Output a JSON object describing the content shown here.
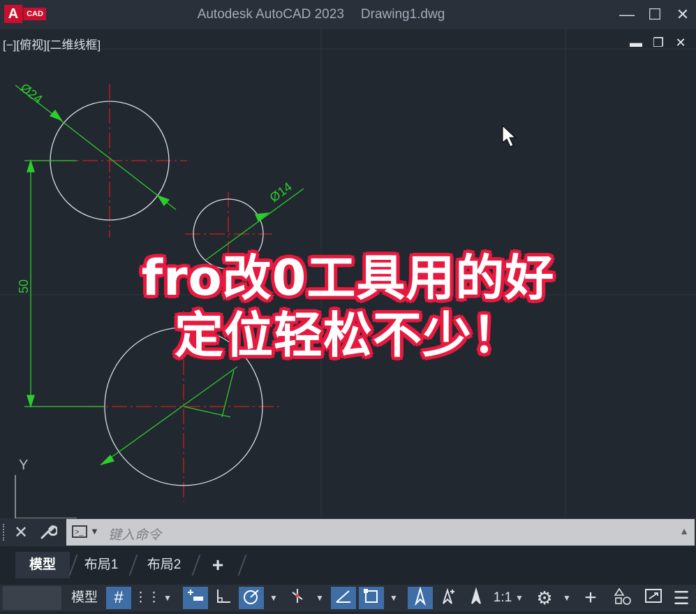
{
  "app": {
    "logo_letter": "A",
    "logo_text": "CAD",
    "title": "Autodesk AutoCAD 2023",
    "document": "Drawing1.dwg"
  },
  "window_controls": {
    "minimize": "—",
    "maximize": "☐",
    "close": "✕"
  },
  "viewport": {
    "label": "[−][俯视][二维线框]",
    "controls": {
      "minimize": "▬",
      "restore": "❐",
      "close": "✕"
    }
  },
  "drawing": {
    "dimensions": {
      "dia_large": "Ø24",
      "dia_small": "Ø14",
      "vertical": "50"
    },
    "ucs_y_label": "Y"
  },
  "overlay": {
    "line1": "fro改0工具用的好",
    "line2": "定位轻松不少！"
  },
  "command_line": {
    "placeholder": "键入命令",
    "close_icon": "✕",
    "wrench_icon": "🔧",
    "dropdown": "▼",
    "scroll_up": "▲"
  },
  "tabs": {
    "items": [
      {
        "label": "模型",
        "active": true
      },
      {
        "label": "布局1",
        "active": false
      },
      {
        "label": "布局2",
        "active": false
      }
    ],
    "add": "+"
  },
  "status_bar": {
    "model_label": "模型",
    "grid_icon": "#",
    "snap_icon": "⋮⋮",
    "scale": "1:1",
    "settings_icon": "⚙",
    "plus_icon": "+",
    "menu_icon": "☰"
  },
  "colors": {
    "background": "#212830",
    "circle": "#d9dde2",
    "center_line": "#cc2020",
    "dimension": "#2ecc2e",
    "overlay_fill": "#ffffff",
    "overlay_outline": "#e8193f",
    "active_toggle": "#3f6ea6"
  }
}
